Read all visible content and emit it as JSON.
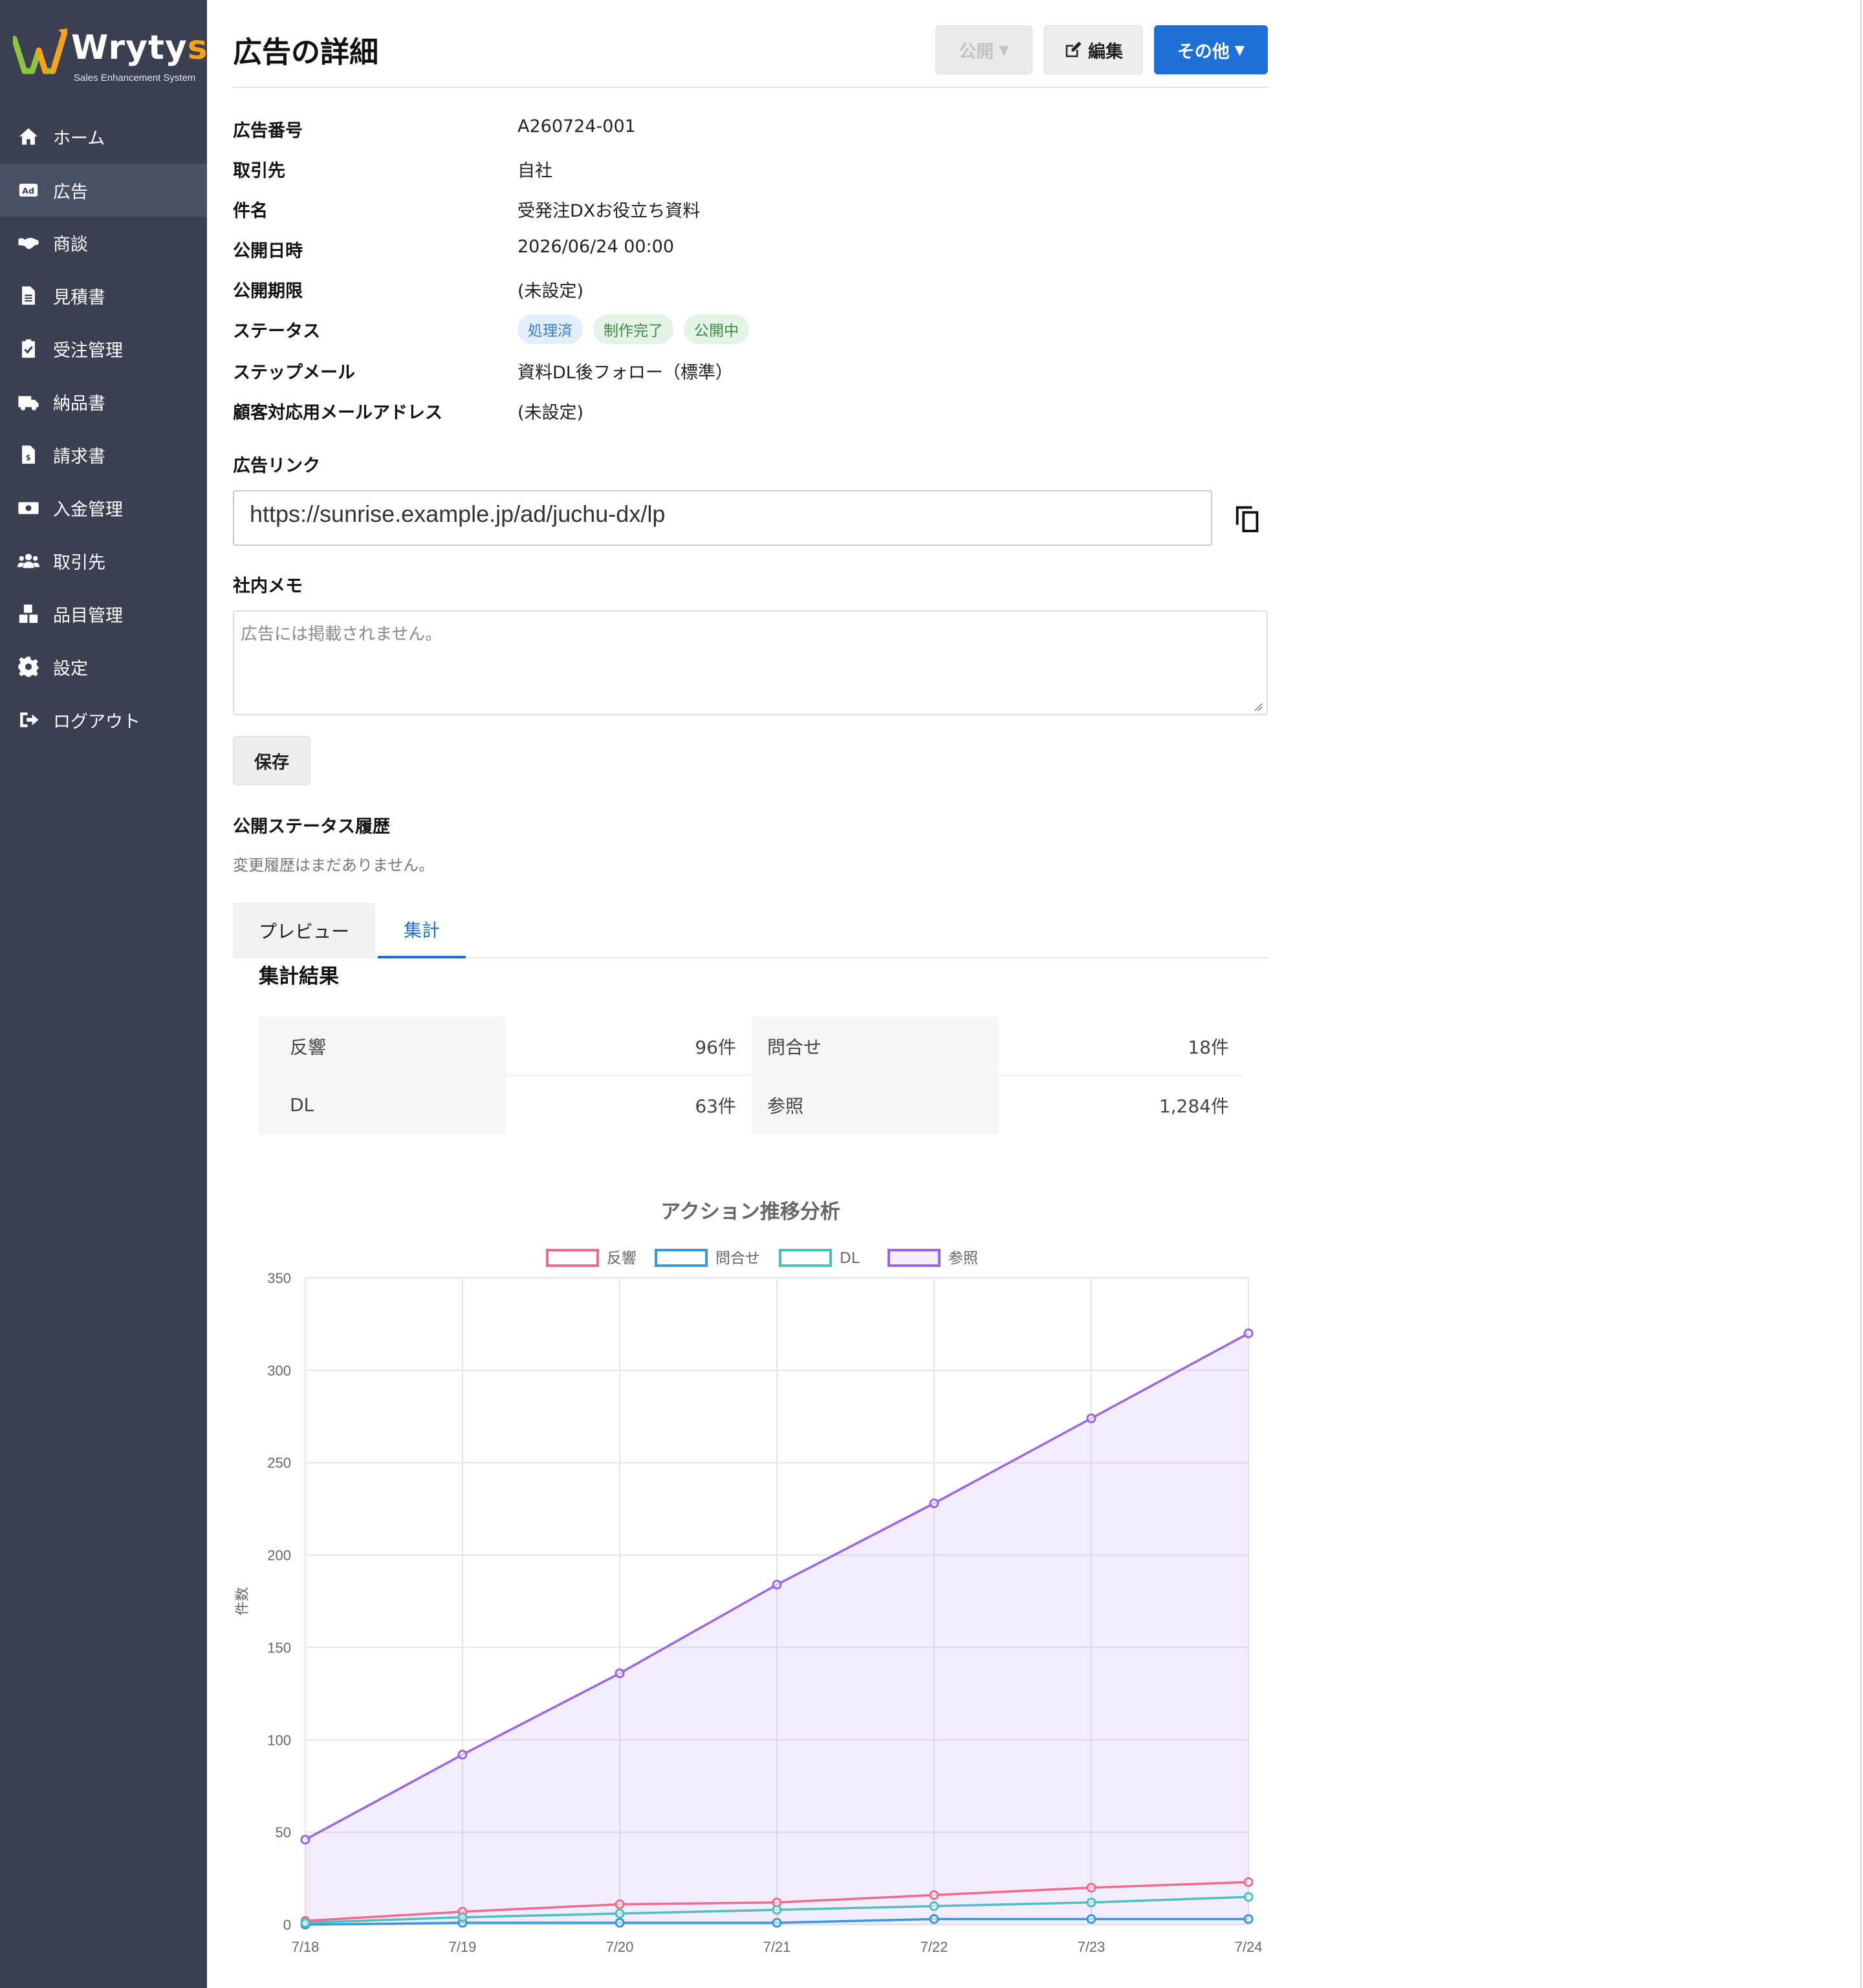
{
  "app": {
    "brand_name_left": "Wryty",
    "brand_name_right": "s",
    "tagline": "Sales Enhancement System",
    "accent_color": "#f6a21b",
    "sidebar_color": "#3a3f51"
  },
  "sidebar": {
    "items": [
      {
        "label": "ホーム",
        "icon": "home-icon",
        "active": false
      },
      {
        "label": "広告",
        "icon": "ad-icon",
        "active": true
      },
      {
        "label": "商談",
        "icon": "handshake-icon",
        "active": false
      },
      {
        "label": "見積書",
        "icon": "document-icon",
        "active": false
      },
      {
        "label": "受注管理",
        "icon": "clipboard-check-icon",
        "active": false
      },
      {
        "label": "納品書",
        "icon": "truck-icon",
        "active": false
      },
      {
        "label": "請求書",
        "icon": "invoice-icon",
        "active": false
      },
      {
        "label": "入金管理",
        "icon": "money-icon",
        "active": false
      },
      {
        "label": "取引先",
        "icon": "users-icon",
        "active": false
      },
      {
        "label": "品目管理",
        "icon": "boxes-icon",
        "active": false
      },
      {
        "label": "設定",
        "icon": "gear-icon",
        "active": false
      },
      {
        "label": "ログアウト",
        "icon": "logout-icon",
        "active": false
      }
    ]
  },
  "header": {
    "title": "広告の詳細",
    "publish_label": "公開",
    "edit_label": "編集",
    "more_label": "その他",
    "primary_color": "#1e6fd6"
  },
  "details": {
    "ad_number_label": "広告番号",
    "ad_number": "A260724-001",
    "client_label": "取引先",
    "client": "自社",
    "subject_label": "件名",
    "subject": "受発注DXお役立ち資料",
    "publish_date_label": "公開日時",
    "publish_date": "2026/06/24 00:00",
    "publish_limit_label": "公開期限",
    "publish_limit": "(未設定)",
    "status_label": "ステータス",
    "status_badges": [
      "処理済",
      "制作完了",
      "公開中"
    ],
    "step_mail_label": "ステップメール",
    "step_mail": "資料DL後フォロー（標準）",
    "support_email_label": "顧客対応用メールアドレス",
    "support_email": "(未設定)"
  },
  "link": {
    "label": "広告リンク",
    "url": "https://sunrise.example.jp/ad/juchu-dx/lp"
  },
  "memo": {
    "label": "社内メモ",
    "placeholder": "広告には掲載されません。",
    "save_label": "保存"
  },
  "history": {
    "label": "公開ステータス履歴",
    "empty_text": "変更履歴はまだありません。"
  },
  "tabs": [
    {
      "label": "プレビュー",
      "active": false
    },
    {
      "label": "集計",
      "active": true
    }
  ],
  "stats": {
    "title": "集計結果",
    "rows": [
      [
        {
          "label": "反響",
          "value": "96件"
        },
        {
          "label": "問合せ",
          "value": "18件"
        }
      ],
      [
        {
          "label": "DL",
          "value": "63件"
        },
        {
          "label": "参照",
          "value": "1,284件"
        }
      ]
    ]
  },
  "chart_data": {
    "type": "line",
    "title": "アクション推移分析",
    "xlabel": "",
    "ylabel": "件数",
    "categories": [
      "7/18",
      "7/19",
      "7/20",
      "7/21",
      "7/22",
      "7/23",
      "7/24"
    ],
    "ylim": [
      0,
      350
    ],
    "yticks": [
      0,
      50,
      100,
      150,
      200,
      250,
      300,
      350
    ],
    "grid": true,
    "legend_position": "top",
    "series": [
      {
        "name": "反響",
        "color": "#f06a8c",
        "values": [
          2,
          7,
          11,
          12,
          16,
          20,
          23
        ]
      },
      {
        "name": "問合せ",
        "color": "#3b97dd",
        "values": [
          0,
          1,
          1,
          1,
          3,
          3,
          3
        ]
      },
      {
        "name": "DL",
        "color": "#4bc0c0",
        "values": [
          1,
          4,
          6,
          8,
          10,
          12,
          15
        ]
      },
      {
        "name": "参照",
        "color": "#9966e8",
        "values": [
          46,
          92,
          136,
          184,
          228,
          274,
          320
        ],
        "fill": true
      }
    ]
  }
}
